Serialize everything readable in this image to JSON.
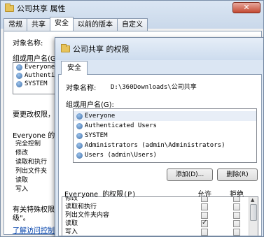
{
  "back_window": {
    "title": "公司共享 属性",
    "close_label": "✕",
    "tabs": [
      "常规",
      "共享",
      "安全",
      "以前的版本",
      "自定义"
    ],
    "object_label": "对象名称:",
    "group_label": "组或用户名(G",
    "users": [
      "Everyone",
      "Authenticat",
      "SYSTEM"
    ],
    "change_perm_text": "要更改权限，",
    "perm_label": "Everyone 的权",
    "perms": [
      "完全控制",
      "修改",
      "读取和执行",
      "列出文件夹",
      "读取",
      "写入"
    ],
    "special_text_1": "有关特殊权限",
    "special_text_2": "级\"。",
    "link_text": "了解访问控制"
  },
  "dialog": {
    "title": "公司共享 的权限",
    "tab": "安全",
    "object_label": "对象名称:",
    "object_value": "D:\\360Downloads\\公司共享",
    "group_label": "组或用户名(G):",
    "users": [
      "Everyone",
      "Authenticated Users",
      "SYSTEM",
      "Administrators (admin\\Administrators)",
      "Users (admin\\Users)"
    ],
    "add_button": "添加(D)...",
    "remove_button": "删除(R)",
    "perm_label": "Everyone 的权限(P)",
    "allow_header": "允许",
    "deny_header": "拒绝",
    "perms": [
      {
        "name": "修改",
        "allow": false,
        "deny": false
      },
      {
        "name": "读取和执行",
        "allow": false,
        "deny": false
      },
      {
        "name": "列出文件夹内容",
        "allow": false,
        "deny": false
      },
      {
        "name": "读取",
        "allow": true,
        "deny": false
      },
      {
        "name": "写入",
        "allow": false,
        "deny": false
      }
    ]
  }
}
